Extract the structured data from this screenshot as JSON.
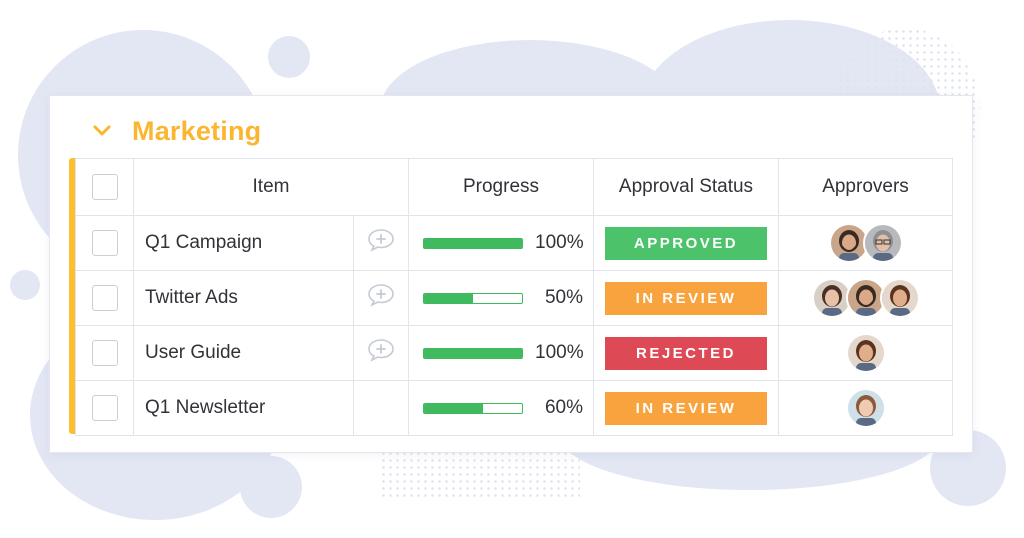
{
  "group": {
    "title": "Marketing",
    "accent_color": "#fbb631",
    "collapse_icon": "chevron-down-icon"
  },
  "columns": [
    "Item",
    "Progress",
    "Approval Status",
    "Approvers"
  ],
  "rows": [
    {
      "item": "Q1 Campaign",
      "has_update_icon": true,
      "progress": 1.0,
      "progress_label": "100%",
      "status": "APPROVED",
      "status_color": "#4cc36b",
      "approvers": [
        "bearded-man",
        "bald-man"
      ]
    },
    {
      "item": "Twitter Ads",
      "has_update_icon": true,
      "progress": 0.5,
      "progress_label": "50%",
      "status": "IN REVIEW",
      "status_color": "#f8a33e",
      "approvers": [
        "woman-dark-hair",
        "bearded-man",
        "woman-curly-hair"
      ]
    },
    {
      "item": "User Guide",
      "has_update_icon": true,
      "progress": 1.0,
      "progress_label": "100%",
      "status": "REJECTED",
      "status_color": "#dd4955",
      "approvers": [
        "woman-curly-hair"
      ]
    },
    {
      "item": "Q1 Newsletter",
      "has_update_icon": false,
      "progress": 0.6,
      "progress_label": "60%",
      "status": "IN REVIEW",
      "status_color": "#f8a33e",
      "approvers": [
        "woman-blonde"
      ]
    }
  ],
  "colors": {
    "progress_green": "#3fba5f",
    "group_bar": "#fbc02d"
  }
}
